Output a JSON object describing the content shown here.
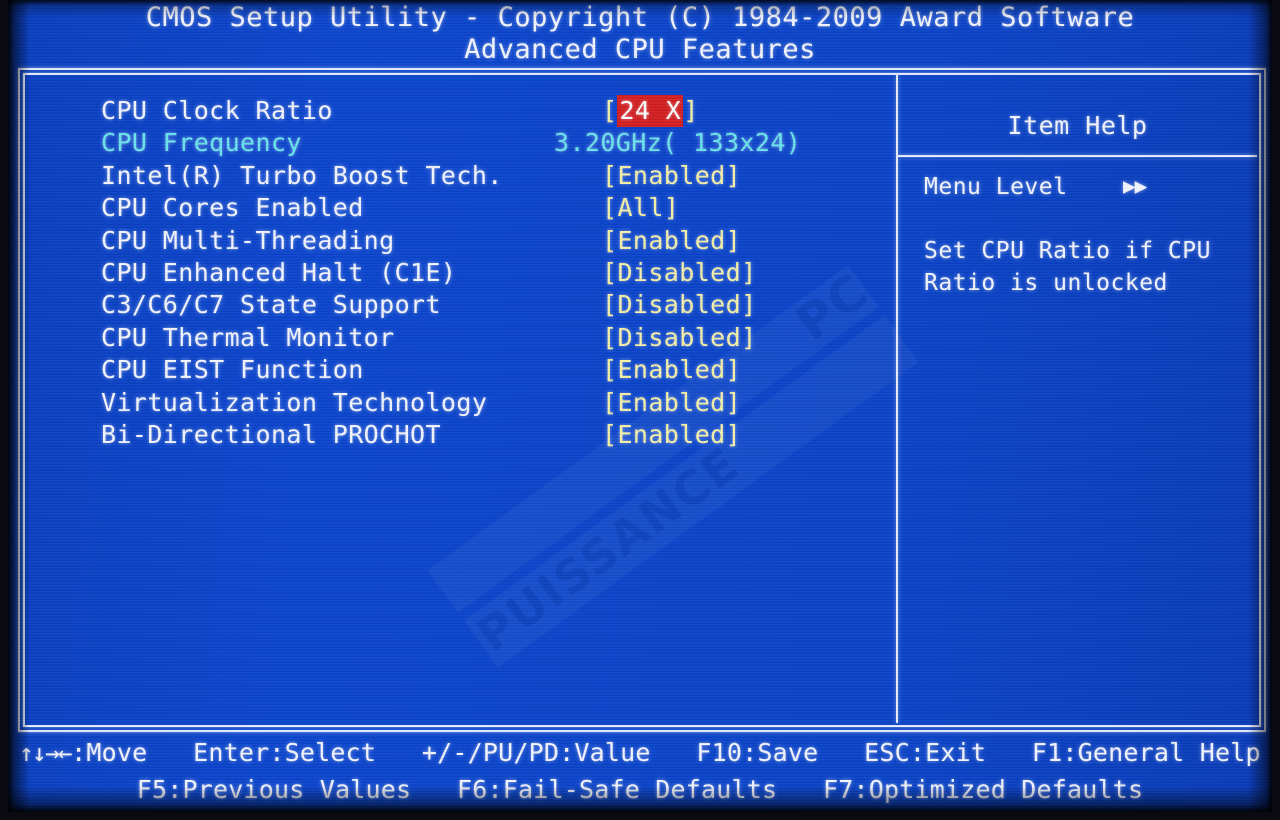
{
  "screen": {
    "bg_color": "#0b44c8",
    "border_color": "#e8eeff",
    "label_color": "#f4f6ff",
    "value_color": "#f7f2a8",
    "info_color": "#6ae6ee",
    "highlight_bg": "#d41f22",
    "highlight_fg": "#ffffff"
  },
  "header": {
    "title": "CMOS Setup Utility - Copyright (C) 1984-2009 Award Software",
    "subtitle": "Advanced CPU Features"
  },
  "settings": {
    "rows": [
      {
        "label": "CPU Clock Ratio",
        "value": "24 X",
        "type": "selected",
        "bracketed": true
      },
      {
        "label": "CPU Frequency",
        "value": "3.20GHz( 133x24)",
        "type": "info",
        "bracketed": false
      },
      {
        "label": "Intel(R) Turbo Boost Tech.",
        "value": "Enabled",
        "type": "option",
        "bracketed": true
      },
      {
        "label": "CPU Cores Enabled",
        "value": "All",
        "type": "option",
        "bracketed": true
      },
      {
        "label": "CPU Multi-Threading",
        "value": "Enabled",
        "type": "option",
        "bracketed": true
      },
      {
        "label": "CPU Enhanced Halt (C1E)",
        "value": "Disabled",
        "type": "option",
        "bracketed": true
      },
      {
        "label": "C3/C6/C7 State Support",
        "value": "Disabled",
        "type": "option",
        "bracketed": true
      },
      {
        "label": "CPU Thermal Monitor",
        "value": "Disabled",
        "type": "option",
        "bracketed": true
      },
      {
        "label": "CPU EIST Function",
        "value": "Enabled",
        "type": "option",
        "bracketed": true
      },
      {
        "label": "Virtualization Technology",
        "value": "Enabled",
        "type": "option",
        "bracketed": true
      },
      {
        "label": "Bi-Directional PROCHOT",
        "value": "Enabled",
        "type": "option",
        "bracketed": true
      }
    ]
  },
  "item_help": {
    "title": "Item Help",
    "menu_level_label": "Menu Level",
    "menu_level_arrows": "▶▶",
    "body_line_1": "Set CPU Ratio if CPU",
    "body_line_2": "Ratio is unlocked"
  },
  "footer": {
    "move_arrows": "↑↓→←",
    "line1": ":Move   Enter:Select   +/-/PU/PD:Value   F10:Save   ESC:Exit   F1:General Help",
    "line2": "F5:Previous Values   F6:Fail-Safe Defaults   F7:Optimized Defaults"
  },
  "watermark": {
    "text_main": "PUISSANCE",
    "text_suffix": "PC"
  }
}
